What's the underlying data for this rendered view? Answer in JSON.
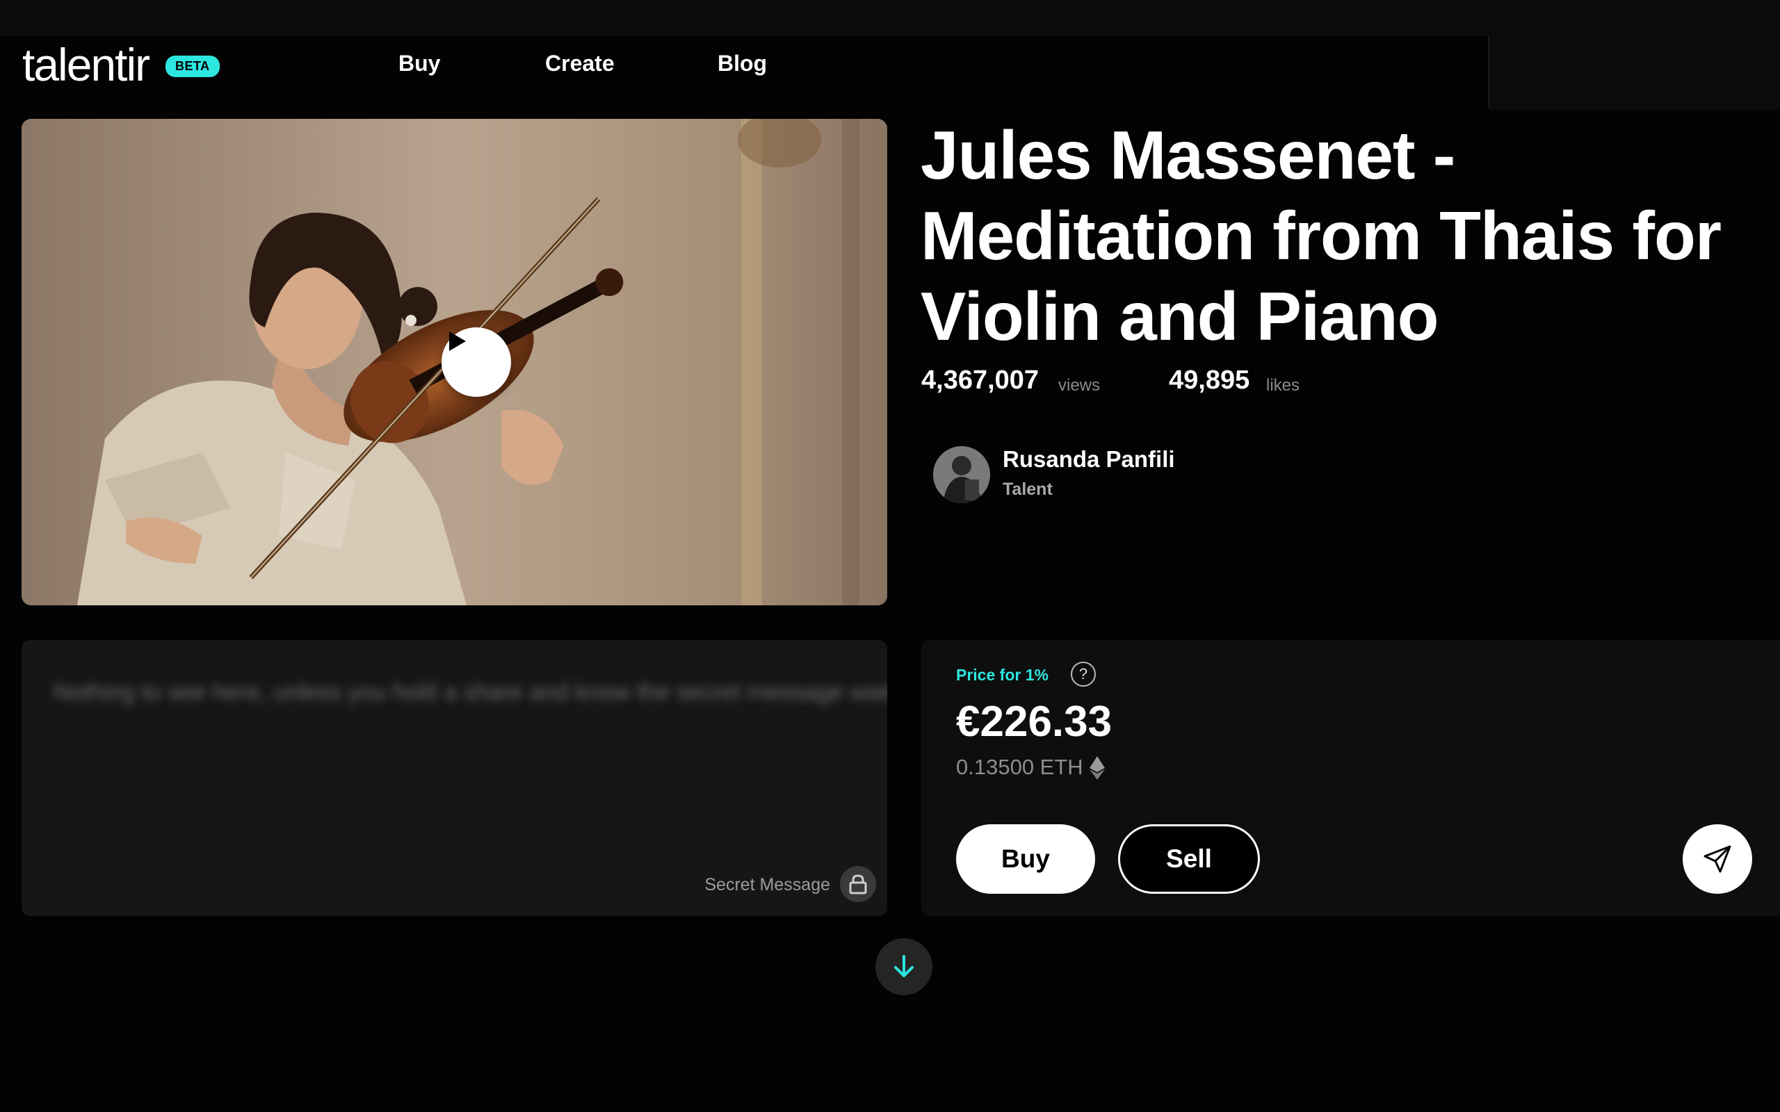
{
  "header": {
    "logo": "talentir",
    "badge": "BETA",
    "nav": [
      "Buy",
      "Create",
      "Blog"
    ]
  },
  "video": {
    "play_icon": "play-icon"
  },
  "title": "Jules Massenet - Meditation from Thais for Violin and Piano",
  "stats": {
    "views_value": "4,367,007",
    "views_label": "views",
    "likes_value": "49,895",
    "likes_label": "likes"
  },
  "artist": {
    "name": "Rusanda Panfili",
    "role": "Talent"
  },
  "secret": {
    "blurred_text": "Nothing to see here, unless you hold a share and know the secret message waiting for you",
    "label": "Secret Message",
    "icon": "lock-icon"
  },
  "price": {
    "label": "Price for 1%",
    "help_icon": "?",
    "eur": "€226.33",
    "eth": "0.13500 ETH",
    "buy": "Buy",
    "sell": "Sell",
    "share_icon": "send-icon"
  },
  "colors": {
    "accent": "#2ee6e0",
    "background": "#030303",
    "card": "#161616"
  },
  "scroll_icon": "arrow-down-icon"
}
